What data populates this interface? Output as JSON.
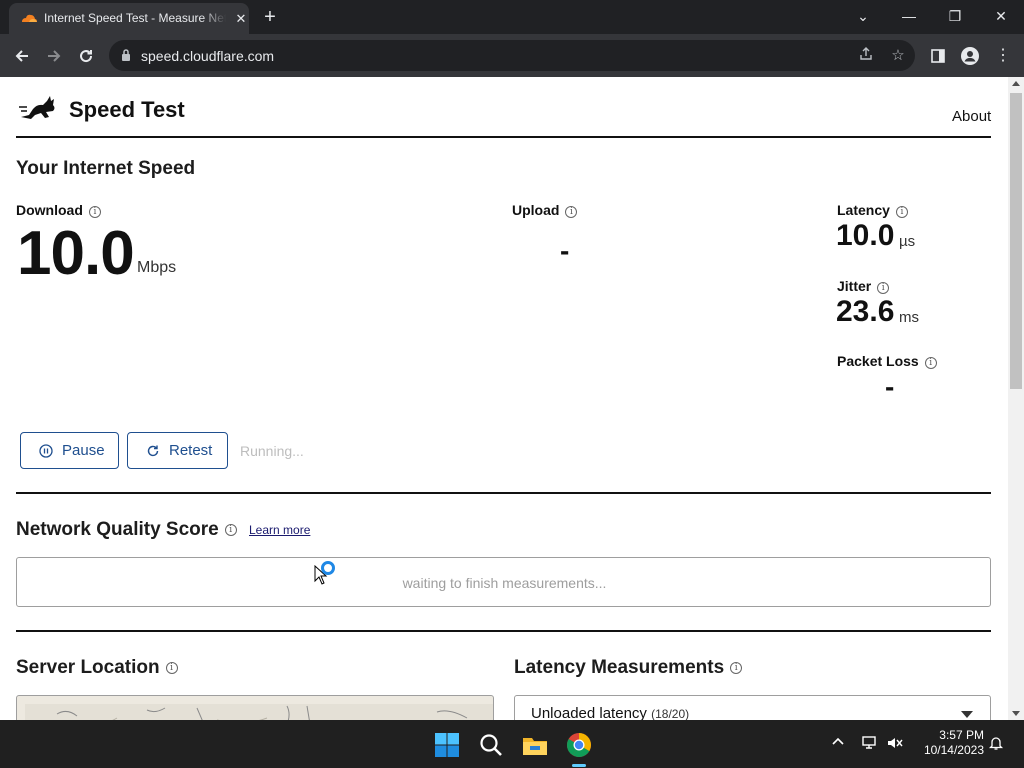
{
  "browser": {
    "tab_title": "Internet Speed Test - Measure Network Performance",
    "tab_close": "✕",
    "new_tab": "+",
    "url": "speed.cloudflare.com",
    "window_controls": {
      "dropdown": "⌄",
      "minimize": "—",
      "restore": "❐",
      "close": "✕"
    }
  },
  "header": {
    "title": "Speed Test",
    "about_link": "About"
  },
  "internet_speed": {
    "heading": "Your Internet Speed",
    "download": {
      "label": "Download",
      "value": "10.0",
      "unit": "Mbps"
    },
    "upload": {
      "label": "Upload",
      "value": "-"
    },
    "latency": {
      "label": "Latency",
      "value": "10.0",
      "unit": "µs"
    },
    "jitter": {
      "label": "Jitter",
      "value": "23.6",
      "unit": "ms"
    },
    "packet_loss": {
      "label": "Packet Loss",
      "value": "-"
    }
  },
  "controls": {
    "pause_label": "Pause",
    "retest_label": "Retest",
    "status": "Running..."
  },
  "network_quality": {
    "heading": "Network Quality Score",
    "learn_more": "Learn more",
    "status": "waiting to finish measurements..."
  },
  "server_location": {
    "heading": "Server Location"
  },
  "latency_measurements": {
    "heading": "Latency Measurements",
    "selected": "Unloaded latency",
    "count": "(18/20)"
  },
  "taskbar": {
    "time": "3:57 PM",
    "date": "10/14/2023"
  },
  "colors": {
    "accent": "#1f4f8f",
    "browser_dark": "#202124",
    "browser_toolbar": "#35363a",
    "taskbar": "#202020",
    "cloudflare_orange": "#f38020"
  }
}
